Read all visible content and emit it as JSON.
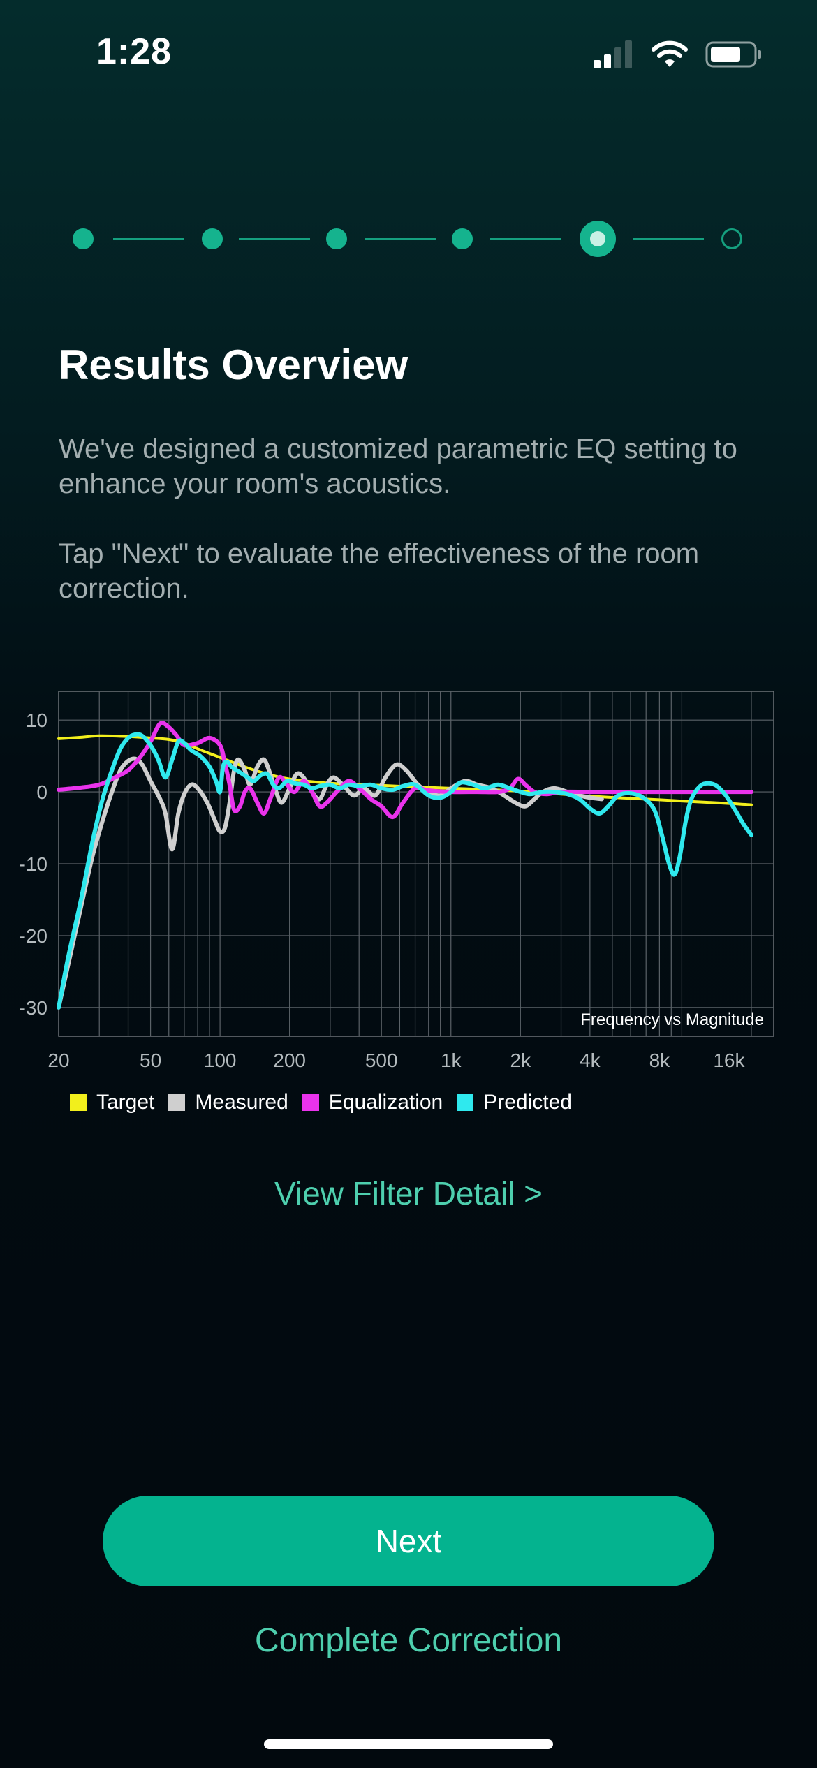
{
  "status_bar": {
    "time": "1:28",
    "icons": [
      "cellular-signal-icon",
      "wifi-icon",
      "battery-icon"
    ]
  },
  "stepper": {
    "total_steps": 6,
    "current_step": 5
  },
  "content": {
    "title": "Results Overview",
    "paragraph_1": "We've designed a customized parametric EQ setting to enhance your room's acoustics.",
    "paragraph_2": "Tap \"Next\" to evaluate the effectiveness of the room correction."
  },
  "chart_data": {
    "type": "line",
    "annotation": "Frequency vs Magnitude",
    "x_scale": "log",
    "xlim": [
      20,
      25000
    ],
    "ylim": [
      -34,
      14
    ],
    "x_ticks": [
      {
        "value": 20,
        "label": "20"
      },
      {
        "value": 50,
        "label": "50"
      },
      {
        "value": 100,
        "label": "100"
      },
      {
        "value": 200,
        "label": "200"
      },
      {
        "value": 500,
        "label": "500"
      },
      {
        "value": 1000,
        "label": "1k"
      },
      {
        "value": 2000,
        "label": "2k"
      },
      {
        "value": 4000,
        "label": "4k"
      },
      {
        "value": 8000,
        "label": "8k"
      },
      {
        "value": 16000,
        "label": "16k"
      }
    ],
    "y_ticks": [
      {
        "value": 10,
        "label": "10"
      },
      {
        "value": 0,
        "label": "0"
      },
      {
        "value": -10,
        "label": "-10"
      },
      {
        "value": -20,
        "label": "-20"
      },
      {
        "value": -30,
        "label": "-30"
      }
    ],
    "grid": true,
    "legend_position": "bottom-left",
    "series": [
      {
        "name": "Target",
        "color": "#f2ef1c",
        "points": [
          [
            20,
            7.4
          ],
          [
            25,
            7.6
          ],
          [
            30,
            7.8
          ],
          [
            40,
            7.7
          ],
          [
            50,
            7.5
          ],
          [
            60,
            7.3
          ],
          [
            70,
            6.8
          ],
          [
            80,
            6.0
          ],
          [
            100,
            4.8
          ],
          [
            130,
            3.4
          ],
          [
            160,
            2.5
          ],
          [
            200,
            1.8
          ],
          [
            300,
            1.2
          ],
          [
            500,
            0.9
          ],
          [
            700,
            0.7
          ],
          [
            1000,
            0.5
          ],
          [
            1500,
            0.3
          ],
          [
            2000,
            0.1
          ],
          [
            3000,
            -0.3
          ],
          [
            4000,
            -0.6
          ],
          [
            6000,
            -0.9
          ],
          [
            8000,
            -1.1
          ],
          [
            12000,
            -1.4
          ],
          [
            16000,
            -1.6
          ],
          [
            20000,
            -1.8
          ]
        ]
      },
      {
        "name": "Measured",
        "color": "#cfcfcf",
        "points": [
          [
            20,
            -30
          ],
          [
            22,
            -24
          ],
          [
            25,
            -16
          ],
          [
            28,
            -9
          ],
          [
            31,
            -4
          ],
          [
            34,
            0
          ],
          [
            37,
            3
          ],
          [
            40,
            4.3
          ],
          [
            43,
            4.6
          ],
          [
            46,
            3.8
          ],
          [
            50,
            1.5
          ],
          [
            55,
            -1
          ],
          [
            58,
            -3
          ],
          [
            62,
            -8
          ],
          [
            66,
            -3
          ],
          [
            70,
            -0.3
          ],
          [
            75,
            1
          ],
          [
            80,
            0.5
          ],
          [
            88,
            -1.5
          ],
          [
            95,
            -4
          ],
          [
            100,
            -5.5
          ],
          [
            105,
            -5
          ],
          [
            110,
            -1.5
          ],
          [
            115,
            3
          ],
          [
            120,
            4.5
          ],
          [
            128,
            3
          ],
          [
            135,
            1
          ],
          [
            145,
            3.5
          ],
          [
            155,
            4.5
          ],
          [
            165,
            2.5
          ],
          [
            175,
            0
          ],
          [
            185,
            -1.5
          ],
          [
            200,
            0.5
          ],
          [
            215,
            2.5
          ],
          [
            230,
            2
          ],
          [
            250,
            0
          ],
          [
            270,
            -1
          ],
          [
            290,
            1
          ],
          [
            310,
            2
          ],
          [
            340,
            1
          ],
          [
            380,
            -0.5
          ],
          [
            420,
            0.5
          ],
          [
            470,
            -0.5
          ],
          [
            520,
            2
          ],
          [
            580,
            3.8
          ],
          [
            640,
            3
          ],
          [
            720,
            1
          ],
          [
            800,
            0
          ],
          [
            900,
            -0.5
          ],
          [
            1000,
            0.5
          ],
          [
            1150,
            1.5
          ],
          [
            1300,
            1
          ],
          [
            1500,
            0.5
          ],
          [
            1700,
            -0.5
          ],
          [
            1900,
            -1.5
          ],
          [
            2100,
            -2
          ],
          [
            2300,
            -1
          ],
          [
            2500,
            0
          ],
          [
            2800,
            0.5
          ],
          [
            3200,
            0
          ],
          [
            3600,
            -0.5
          ],
          [
            4000,
            -0.8
          ],
          [
            4500,
            -1
          ]
        ]
      },
      {
        "name": "Equalization",
        "color": "#ea33ec",
        "points": [
          [
            20,
            0.3
          ],
          [
            25,
            0.6
          ],
          [
            30,
            1.0
          ],
          [
            35,
            2.0
          ],
          [
            40,
            3.0
          ],
          [
            45,
            4.8
          ],
          [
            50,
            7.0
          ],
          [
            55,
            9.5
          ],
          [
            60,
            9.0
          ],
          [
            65,
            7.8
          ],
          [
            70,
            6.5
          ],
          [
            80,
            6.8
          ],
          [
            90,
            7.5
          ],
          [
            100,
            6.5
          ],
          [
            105,
            4
          ],
          [
            110,
            1
          ],
          [
            115,
            -2.5
          ],
          [
            122,
            -2
          ],
          [
            128,
            0
          ],
          [
            135,
            0.5
          ],
          [
            145,
            -1.5
          ],
          [
            155,
            -3
          ],
          [
            165,
            -1
          ],
          [
            180,
            2
          ],
          [
            195,
            1
          ],
          [
            210,
            0
          ],
          [
            230,
            1.5
          ],
          [
            250,
            0
          ],
          [
            270,
            -2
          ],
          [
            290,
            -1.5
          ],
          [
            320,
            0
          ],
          [
            360,
            1.5
          ],
          [
            400,
            0.5
          ],
          [
            450,
            -1
          ],
          [
            500,
            -2
          ],
          [
            560,
            -3.5
          ],
          [
            620,
            -1.5
          ],
          [
            700,
            0.5
          ],
          [
            800,
            0.2
          ],
          [
            1000,
            0
          ],
          [
            1300,
            0
          ],
          [
            1600,
            0
          ],
          [
            1800,
            0.5
          ],
          [
            1950,
            1.8
          ],
          [
            2100,
            1
          ],
          [
            2300,
            0
          ],
          [
            2600,
            -0.3
          ],
          [
            3000,
            0
          ],
          [
            4000,
            0
          ],
          [
            6000,
            0
          ],
          [
            8000,
            0
          ],
          [
            12000,
            0
          ],
          [
            16000,
            0
          ],
          [
            20000,
            0
          ]
        ]
      },
      {
        "name": "Predicted",
        "color": "#2fe9ee",
        "points": [
          [
            20,
            -30
          ],
          [
            22,
            -23
          ],
          [
            25,
            -15
          ],
          [
            28,
            -7
          ],
          [
            31,
            -1
          ],
          [
            34,
            3
          ],
          [
            37,
            6
          ],
          [
            40,
            7.5
          ],
          [
            43,
            8
          ],
          [
            46,
            7.8
          ],
          [
            50,
            6.5
          ],
          [
            54,
            4.5
          ],
          [
            58,
            2
          ],
          [
            62,
            4.5
          ],
          [
            66,
            7
          ],
          [
            70,
            6.8
          ],
          [
            75,
            5.8
          ],
          [
            82,
            5
          ],
          [
            90,
            3.5
          ],
          [
            96,
            1.5
          ],
          [
            100,
            0
          ],
          [
            103,
            3.5
          ],
          [
            107,
            4.2
          ],
          [
            112,
            3.5
          ],
          [
            118,
            3
          ],
          [
            125,
            2.5
          ],
          [
            132,
            2
          ],
          [
            140,
            1.5
          ],
          [
            150,
            2.3
          ],
          [
            160,
            2.5
          ],
          [
            170,
            1
          ],
          [
            180,
            0.5
          ],
          [
            195,
            1.5
          ],
          [
            210,
            1.2
          ],
          [
            230,
            1
          ],
          [
            250,
            0.5
          ],
          [
            270,
            0.8
          ],
          [
            300,
            1
          ],
          [
            330,
            0.5
          ],
          [
            360,
            1
          ],
          [
            400,
            0.8
          ],
          [
            450,
            1
          ],
          [
            500,
            0.5
          ],
          [
            560,
            0.3
          ],
          [
            620,
            0.8
          ],
          [
            700,
            1
          ],
          [
            800,
            -0.5
          ],
          [
            900,
            -0.8
          ],
          [
            1000,
            0
          ],
          [
            1100,
            1.3
          ],
          [
            1250,
            1
          ],
          [
            1400,
            0.5
          ],
          [
            1600,
            1
          ],
          [
            1800,
            0.5
          ],
          [
            2000,
            0
          ],
          [
            2200,
            -0.3
          ],
          [
            2500,
            0
          ],
          [
            2800,
            0
          ],
          [
            3200,
            -0.3
          ],
          [
            3600,
            -1
          ],
          [
            4000,
            -2.3
          ],
          [
            4400,
            -3
          ],
          [
            4800,
            -2
          ],
          [
            5300,
            -0.5
          ],
          [
            6000,
            -0.2
          ],
          [
            6800,
            -0.8
          ],
          [
            7600,
            -2.5
          ],
          [
            8200,
            -6
          ],
          [
            8800,
            -10
          ],
          [
            9300,
            -11.5
          ],
          [
            9800,
            -9
          ],
          [
            10400,
            -4
          ],
          [
            11000,
            -1
          ],
          [
            12000,
            0.8
          ],
          [
            13000,
            1.2
          ],
          [
            14200,
            0.8
          ],
          [
            15500,
            -0.5
          ],
          [
            17000,
            -2.5
          ],
          [
            18500,
            -4.5
          ],
          [
            20000,
            -6
          ]
        ]
      }
    ]
  },
  "actions": {
    "view_filter": "View Filter Detail >",
    "next": "Next",
    "complete": "Complete Correction"
  }
}
